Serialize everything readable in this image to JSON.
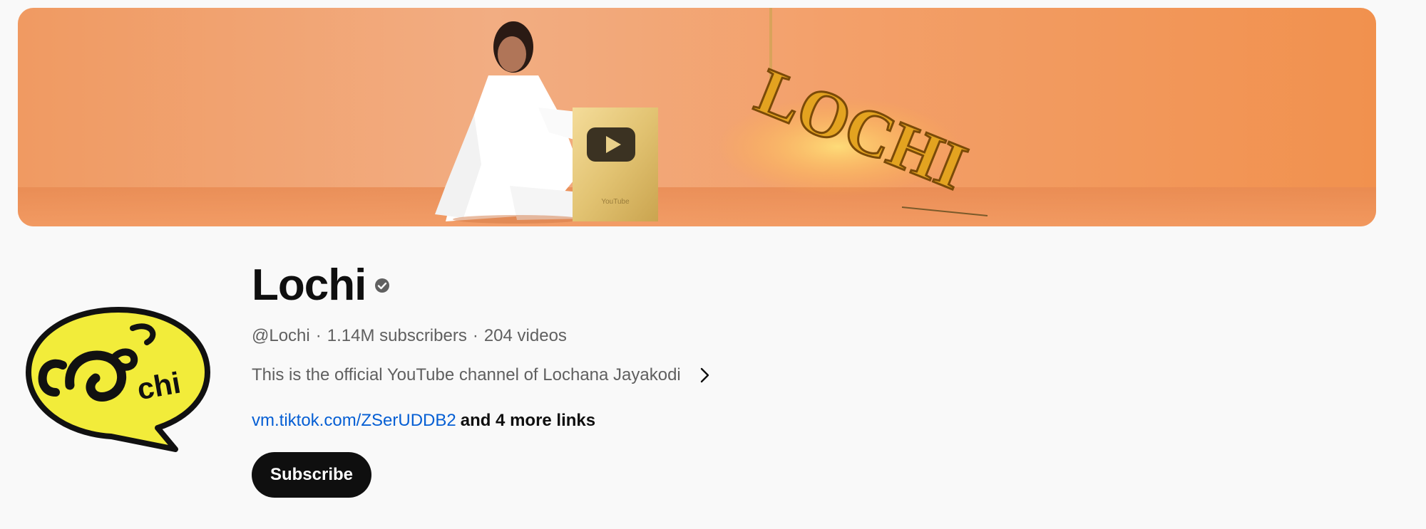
{
  "channel": {
    "name": "Lochi",
    "handle": "@Lochi",
    "subscribers": "1.14M subscribers",
    "videos": "204 videos",
    "separator": "·",
    "description": "This is the official YouTube channel of Lochana Jayakodi",
    "primary_link": "vm.tiktok.com/ZSerUDDB2",
    "more_links": "and 4 more links",
    "subscribe_label": "Subscribe",
    "verified_icon": "verified-check-icon"
  },
  "banner": {
    "sign_text": "LOCHI",
    "plaque_brand": "YouTube",
    "background_color": "#f2955a"
  },
  "avatar": {
    "logo_text": "chi",
    "logo_color": "#f2ec3a"
  },
  "colors": {
    "link": "#065fd4",
    "subscribe_bg": "#0f0f0f",
    "secondary_text": "#606060"
  }
}
